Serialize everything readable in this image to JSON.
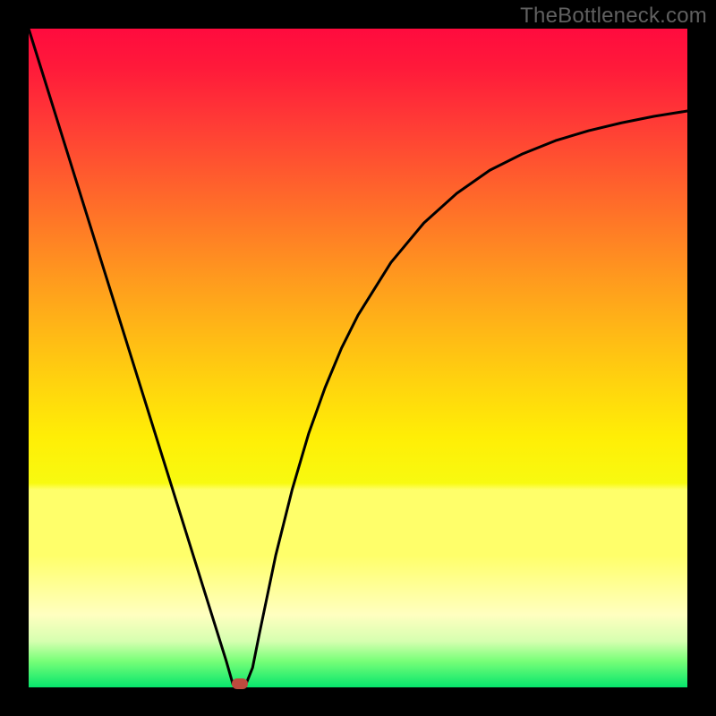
{
  "watermark": "TheBottleneck.com",
  "colors": {
    "frame": "#000000",
    "curve_stroke": "#000000",
    "marker": "#bd4a3e",
    "gradient_top": "#ff0b3e",
    "gradient_bottom": "#06e56c"
  },
  "chart_data": {
    "type": "line",
    "title": "",
    "xlabel": "",
    "ylabel": "",
    "xlim": [
      0,
      100
    ],
    "ylim": [
      0,
      100
    ],
    "x": [
      0,
      2.5,
      5,
      7.5,
      10,
      12.5,
      15,
      17.5,
      20,
      22.5,
      25,
      27.5,
      30,
      31,
      32,
      33,
      34,
      35,
      37.5,
      40,
      42.5,
      45,
      47.5,
      50,
      55,
      60,
      65,
      70,
      75,
      80,
      85,
      90,
      95,
      100
    ],
    "y": [
      100,
      92,
      84,
      76,
      68,
      60,
      52,
      44,
      36,
      28,
      20,
      12,
      4,
      0.5,
      0,
      0.5,
      3,
      8,
      20,
      30,
      38.5,
      45.5,
      51.5,
      56.5,
      64.5,
      70.5,
      75,
      78.5,
      81,
      83,
      84.5,
      85.7,
      86.7,
      87.5
    ],
    "min_point": {
      "x": 32,
      "y": 0
    },
    "marker": {
      "x": 32,
      "y": 0.5
    }
  }
}
